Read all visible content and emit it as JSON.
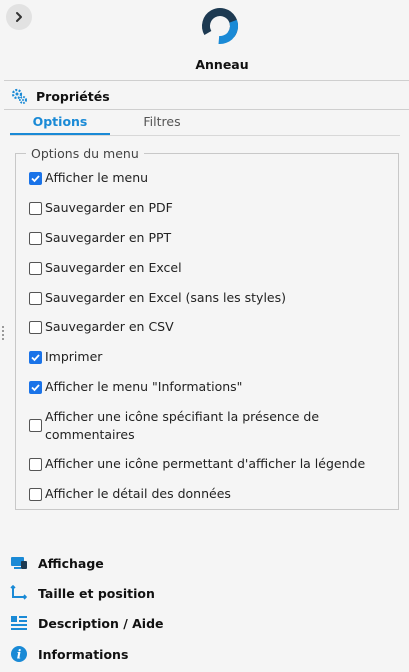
{
  "header": {
    "title": "Anneau"
  },
  "properties": {
    "label": "Propriétés"
  },
  "tabs": [
    {
      "label": "Options",
      "active": true
    },
    {
      "label": "Filtres",
      "active": false
    }
  ],
  "menu_options": {
    "legend": "Options du menu",
    "items": [
      {
        "label": "Afficher le menu",
        "checked": true
      },
      {
        "label": "Sauvegarder en PDF",
        "checked": false
      },
      {
        "label": "Sauvegarder en PPT",
        "checked": false
      },
      {
        "label": "Sauvegarder en Excel",
        "checked": false
      },
      {
        "label": "Sauvegarder en Excel (sans les styles)",
        "checked": false
      },
      {
        "label": "Sauvegarder en CSV",
        "checked": false
      },
      {
        "label": "Imprimer",
        "checked": true
      },
      {
        "label": "Afficher le menu \"Informations\"",
        "checked": true
      },
      {
        "label": "Afficher une icône spécifiant la présence de commentaires",
        "checked": false
      },
      {
        "label": "Afficher une icône permettant d'afficher la légende",
        "checked": false
      },
      {
        "label": "Afficher le détail des données",
        "checked": false
      }
    ]
  },
  "sections": [
    {
      "label": "Affichage",
      "icon": "display-icon"
    },
    {
      "label": "Taille et position",
      "icon": "resize-icon"
    },
    {
      "label": "Description / Aide",
      "icon": "description-icon"
    },
    {
      "label": "Informations",
      "icon": "info-icon"
    }
  ],
  "colors": {
    "accent": "#1a8ad6",
    "checkbox": "#1a73e8",
    "logo_dark": "#1d3a52",
    "logo_blue": "#1a8ad6"
  }
}
